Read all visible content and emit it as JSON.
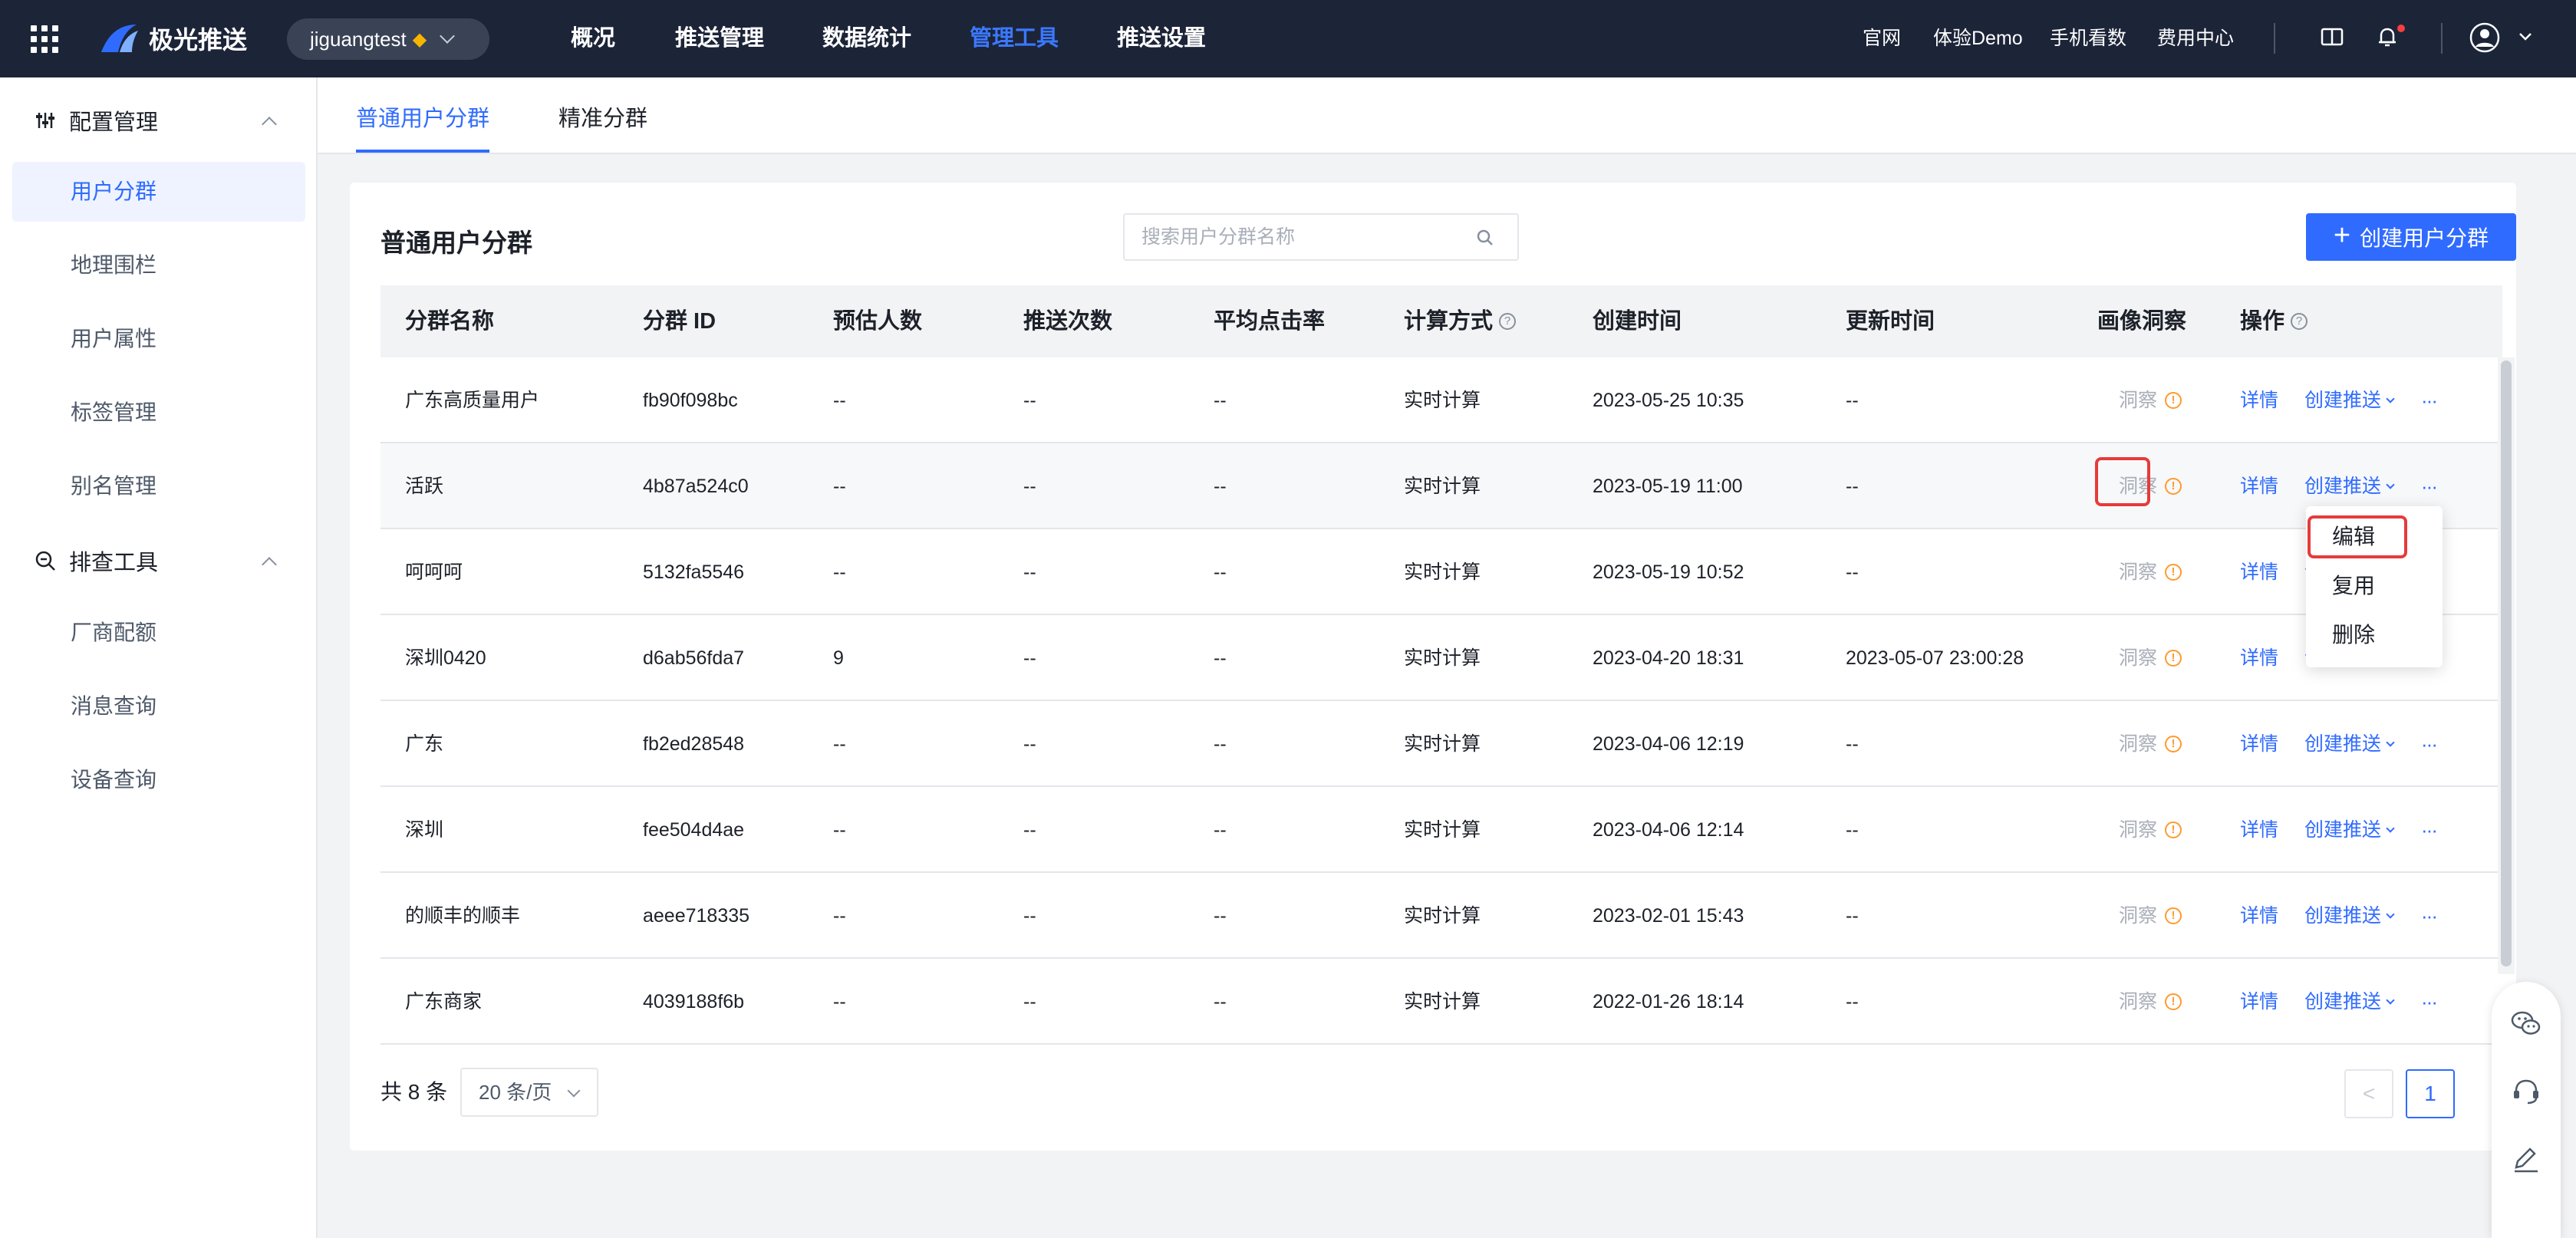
{
  "topbar": {
    "brand": "极光推送",
    "app_name": "jiguangtest",
    "nav": [
      "概况",
      "推送管理",
      "数据统计",
      "管理工具",
      "推送设置"
    ],
    "active_nav": "管理工具",
    "links": [
      "官网",
      "体验Demo",
      "手机看数",
      "费用中心"
    ],
    "accent": "#3b78ff"
  },
  "sidebar": {
    "group1": "配置管理",
    "group1_items": [
      "用户分群",
      "地理围栏",
      "用户属性",
      "标签管理",
      "别名管理"
    ],
    "group2": "排查工具",
    "group2_items": [
      "厂商配额",
      "消息查询",
      "设备查询"
    ],
    "active_item": "用户分群"
  },
  "tabs": [
    "普通用户分群",
    "精准分群"
  ],
  "card": {
    "title": "普通用户分群",
    "search_placeholder": "搜索用户分群名称",
    "create_label": "创建用户分群"
  },
  "table": {
    "headers": [
      "分群名称",
      "分群 ID",
      "预估人数",
      "推送次数",
      "平均点击率",
      "计算方式",
      "创建时间",
      "更新时间",
      "画像洞察",
      "操作"
    ],
    "rows": [
      {
        "name": "广东高质量用户",
        "id": "fb90f098bc",
        "est": "--",
        "pushes": "--",
        "ctr": "--",
        "method": "实时计算",
        "created": "2023-05-25 10:35",
        "updated": "--"
      },
      {
        "name": "活跃",
        "id": "4b87a524c0",
        "est": "--",
        "pushes": "--",
        "ctr": "--",
        "method": "实时计算",
        "created": "2023-05-19 11:00",
        "updated": "--"
      },
      {
        "name": "呵呵呵",
        "id": "5132fa5546",
        "est": "--",
        "pushes": "--",
        "ctr": "--",
        "method": "实时计算",
        "created": "2023-05-19 10:52",
        "updated": "--"
      },
      {
        "name": "深圳0420",
        "id": "d6ab56fda7",
        "est": "9",
        "pushes": "--",
        "ctr": "--",
        "method": "实时计算",
        "created": "2023-04-20 18:31",
        "updated": "2023-05-07 23:00:28"
      },
      {
        "name": "广东",
        "id": "fb2ed28548",
        "est": "--",
        "pushes": "--",
        "ctr": "--",
        "method": "实时计算",
        "created": "2023-04-06 12:19",
        "updated": "--"
      },
      {
        "name": "深圳",
        "id": "fee504d4ae",
        "est": "--",
        "pushes": "--",
        "ctr": "--",
        "method": "实时计算",
        "created": "2023-04-06 12:14",
        "updated": "--"
      },
      {
        "name": "的顺丰的顺丰",
        "id": "aeee718335",
        "est": "--",
        "pushes": "--",
        "ctr": "--",
        "method": "实时计算",
        "created": "2023-02-01 15:43",
        "updated": "--"
      },
      {
        "name": "广东商家",
        "id": "4039188f6b",
        "est": "--",
        "pushes": "--",
        "ctr": "--",
        "method": "实时计算",
        "created": "2022-01-26 18:14",
        "updated": "--"
      }
    ],
    "insight_label": "洞察",
    "detail_label": "详情",
    "create_push_label": "创建推送",
    "more_label": "···"
  },
  "menu": [
    "编辑",
    "复用",
    "删除"
  ],
  "pagination": {
    "total": "共 8 条",
    "page_size": "20 条/页",
    "current": "1",
    "prev": "<"
  }
}
